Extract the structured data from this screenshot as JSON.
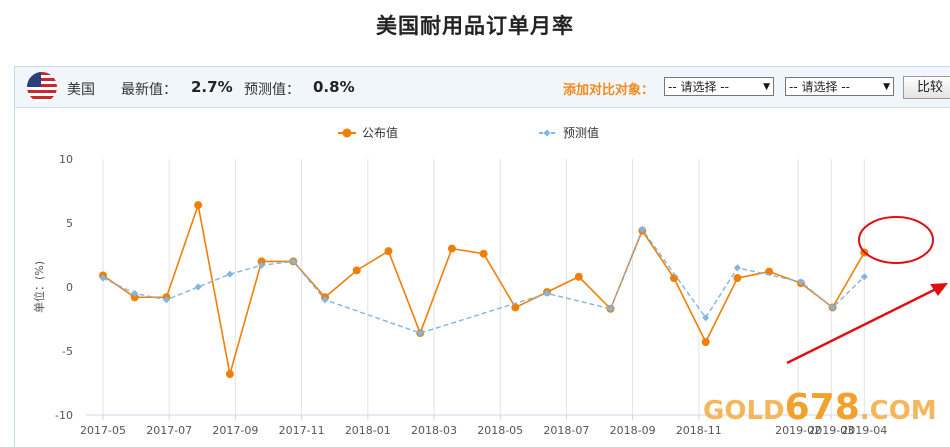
{
  "page": {
    "title": "美国耐用品订单月率"
  },
  "toolbar": {
    "country": "美国",
    "latest_label": "最新值：",
    "latest_value": "2.7%",
    "forecast_label": "预测值：",
    "forecast_value": "0.8%",
    "compare_label": "添加对比对象：",
    "select1": "-- 请选择 --",
    "select2": "-- 请选择 --",
    "compare_button": "比较"
  },
  "watermark": {
    "prefix": "GOLD",
    "number": "678",
    "suffix": ".COM"
  },
  "chart_data": {
    "type": "line",
    "xlabel": "",
    "ylabel": "单位：(%)",
    "ylim": [
      -10,
      10
    ],
    "yticks": [
      10,
      5,
      0,
      -5,
      -10
    ],
    "xticks": [
      "2017-05",
      "2017-07",
      "2017-09",
      "2017-11",
      "2018-01",
      "2018-03",
      "2018-05",
      "2018-07",
      "2018-09",
      "2018-11",
      "2019-02",
      "2019-03",
      "2019-04"
    ],
    "legend_position": "top-center",
    "grid": "vertical",
    "colors": {
      "actual": "#f07f09",
      "forecast": "#7fb6e6"
    },
    "x": [
      "2017-05",
      "2017-06",
      "2017-07",
      "2017-08",
      "2017-09",
      "2017-10",
      "2017-11",
      "2017-12",
      "2018-01",
      "2018-02",
      "2018-03",
      "2018-04",
      "2018-05",
      "2018-06",
      "2018-07",
      "2018-08",
      "2018-09",
      "2018-10",
      "2018-11",
      "2018-12",
      "2019-01",
      "2019-02",
      "2019-03",
      "2019-04"
    ],
    "series": [
      {
        "name": "公布值",
        "values": [
          0.9,
          -0.8,
          -0.8,
          6.4,
          -6.8,
          2.0,
          2.0,
          -0.8,
          1.3,
          2.8,
          -3.6,
          3.0,
          2.6,
          -1.6,
          -0.4,
          0.8,
          -1.7,
          4.4,
          0.7,
          -4.3,
          0.7,
          1.2,
          0.3,
          -1.6,
          2.7
        ]
      },
      {
        "name": "预测值",
        "values": [
          0.7,
          -0.5,
          -1.0,
          0.0,
          1.0,
          1.7,
          2.0,
          -1.0,
          null,
          null,
          -3.6,
          null,
          null,
          null,
          -0.5,
          null,
          -1.7,
          4.5,
          null,
          -2.4,
          1.5,
          null,
          0.4,
          -1.6,
          0.8
        ]
      }
    ]
  }
}
